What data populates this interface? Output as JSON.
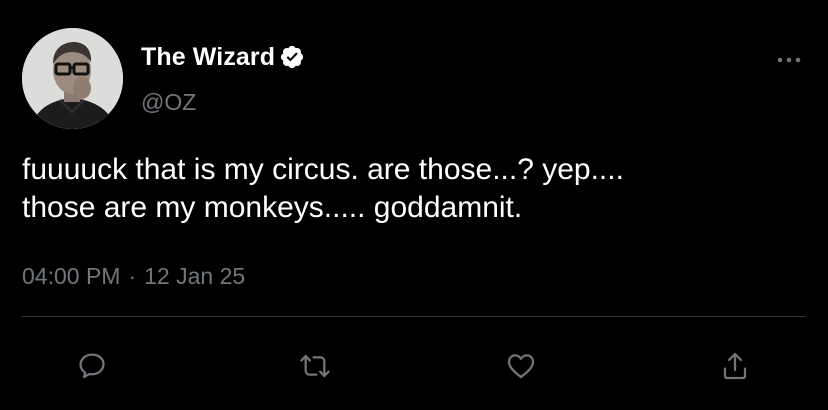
{
  "user": {
    "display_name": "The Wizard",
    "handle": "@OZ",
    "verified": true,
    "avatar_icon": "profile-photo"
  },
  "tweet": {
    "text": "fuuuuck that is my circus. are those...? yep....\nthose are my monkeys..... goddamnit.",
    "time": "04:00 PM",
    "separator": "·",
    "date": "12 Jan 25"
  },
  "actions": [
    {
      "name": "reply",
      "icon": "speech-bubble-icon"
    },
    {
      "name": "retweet",
      "icon": "retweet-arrows-icon"
    },
    {
      "name": "like",
      "icon": "heart-icon"
    },
    {
      "name": "share",
      "icon": "share-upload-icon"
    }
  ],
  "colors": {
    "background": "#000000",
    "primary_text": "#ffffff",
    "secondary_text": "#71767b",
    "divider": "#2f3336",
    "icon": "#71767b"
  }
}
